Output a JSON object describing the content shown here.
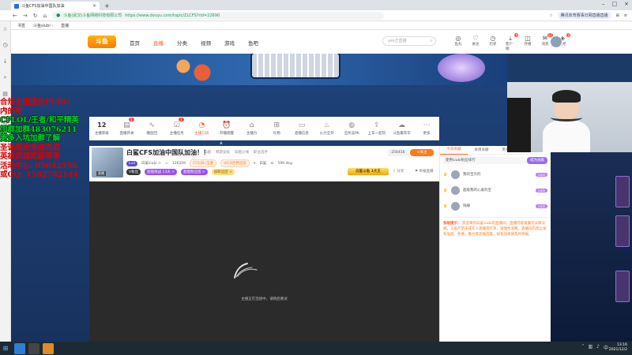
{
  "browser": {
    "tab_title": "斗鱼CFS加油中国队加油",
    "address_site": "斗鱼(武汉)斗鱼网络科技有限公司",
    "address_url": "https://www.douyu.com/topic/ZLCFS?rid=22690",
    "addr_right_pill": "腾讯体育赛事日网直播直播",
    "bookmarks": [
      "书签",
      "斗鱼siubi -",
      "直播"
    ]
  },
  "site": {
    "logo": "斗鱼",
    "nav": [
      "首页",
      "直播",
      "分类",
      "视频",
      "游戏",
      "鱼吧"
    ],
    "search_placeholder": "yes正直播",
    "header_icons": [
      {
        "label": "鱼丸",
        "badge": ""
      },
      {
        "label": "关注",
        "badge": ""
      },
      {
        "label": "历史",
        "badge": ""
      },
      {
        "label": "客户端",
        "badge": "4"
      },
      {
        "label": "开播",
        "badge": ""
      },
      {
        "label": "消息",
        "badge": "57"
      },
      {
        "label": "鱼吧",
        "badge": "2"
      }
    ]
  },
  "overlay": {
    "lines": [
      {
        "text": "合规主播提供PUBG",
        "cls": "ov-red"
      },
      {
        "text": "内的的",
        "cls": "ov-red"
      },
      {
        "text": "CFLOL/王者/和平精英",
        "cls": "ov-green ov-stroke"
      },
      {
        "text": "加群加群483076211",
        "cls": "ov-green ov-stroke"
      },
      {
        "text": "更多入坑加群了解",
        "cls": "ov-green ov-stroke"
      },
      {
        "text": "圣诞装扮充值完成",
        "cls": "ov-red"
      },
      {
        "text": "英雄武器武器等等",
        "cls": "ov-red"
      },
      {
        "text": "活动中心: 05042556",
        "cls": "ov-red"
      },
      {
        "text": "或QQ: 1582782144",
        "cls": "ov-red"
      }
    ]
  },
  "toolbar": [
    {
      "label": "主播等级",
      "glyph": "12",
      "num": true,
      "badge": "",
      "active": false
    },
    {
      "label": "直播开关",
      "glyph": "▤",
      "num": false,
      "badge": "1",
      "active": false
    },
    {
      "label": "播后回",
      "glyph": "∿",
      "num": false,
      "badge": "",
      "active": false
    },
    {
      "label": "主播任务",
      "glyph": "☑",
      "num": false,
      "badge": "1",
      "active": false
    },
    {
      "label": "主播口袋",
      "glyph": "◔",
      "num": false,
      "badge": "",
      "active": true
    },
    {
      "label": "开播提醒",
      "glyph": "⏰",
      "num": false,
      "badge": "",
      "active": false
    },
    {
      "label": "主播力",
      "glyph": "⌂",
      "num": false,
      "badge": "",
      "active": false
    },
    {
      "label": "礼物",
      "glyph": "⊞",
      "num": false,
      "badge": "",
      "active": false
    },
    {
      "label": "直播信息",
      "glyph": "▭",
      "num": false,
      "badge": "",
      "active": false
    },
    {
      "label": "火力全开",
      "glyph": "♨",
      "num": false,
      "badge": "",
      "active": false
    },
    {
      "label": "全民竞PK",
      "glyph": "◍",
      "num": false,
      "badge": "",
      "active": false
    },
    {
      "label": "上车一起玩",
      "glyph": "⇪",
      "num": false,
      "badge": "",
      "active": false
    },
    {
      "label": "斗鱼嘉年华",
      "glyph": "☁",
      "num": false,
      "badge": "",
      "active": false
    },
    {
      "label": "更多",
      "glyph": "⋯",
      "num": false,
      "badge": "",
      "active": false
    }
  ],
  "room": {
    "cover_badge": "直播",
    "title": "白鲨CFS加油中国队加油！！",
    "tags": [
      "穿越",
      "网游竞技",
      "穿越火线",
      "职业选手"
    ],
    "level": "Lv3",
    "owner": "白鲨siubi >",
    "hot": "126209",
    "tag1": "CF/LOL/王者",
    "tag2": "VICA世界冠军",
    "city": "白鲨",
    "weight": "599.4kg",
    "follow_count": "256416",
    "follow_btn": "+关注",
    "badges": [
      "V粉丝",
      "超能挑战 13天 >",
      "超能粉丝团 >",
      "加粉丝团 >"
    ],
    "medal": "白鲨斗鱼 1大王",
    "share": "分享",
    "report": "举报直播"
  },
  "player": {
    "message": "主播正在连接中，请稍后重试"
  },
  "rpanel": {
    "tabs": [
      "今日贡献",
      "本周贡献",
      "贵宾(16)",
      "粉丝(10)"
    ],
    "sub_label": "使用siubi粉丝排行",
    "sub_btn": "成为贡献",
    "rows": [
      {
        "crown": "♛",
        "name": "我的宝贝的",
        "badge": "siubi"
      },
      {
        "crown": "♛",
        "name": "超级我的心爱的宝",
        "badge": "siubi"
      },
      {
        "crown": "♛",
        "name": "快睡",
        "badge": "siubi"
      }
    ],
    "sys_label": "系统提示：",
    "chat": "欢迎来到白鲨siubi的直播间，直播内容请遵守法律法规，斗鱼严禁未成年人直播或打赏，请理性消费。直播间内禁止发布低俗、色情、暴力等违规内容，如有违规请及时举报。"
  },
  "taskbar": {
    "time": "13:16",
    "date": "2021/12/2"
  },
  "colors": {
    "accent": "#ff5d23",
    "brand": "#ff7a00"
  }
}
